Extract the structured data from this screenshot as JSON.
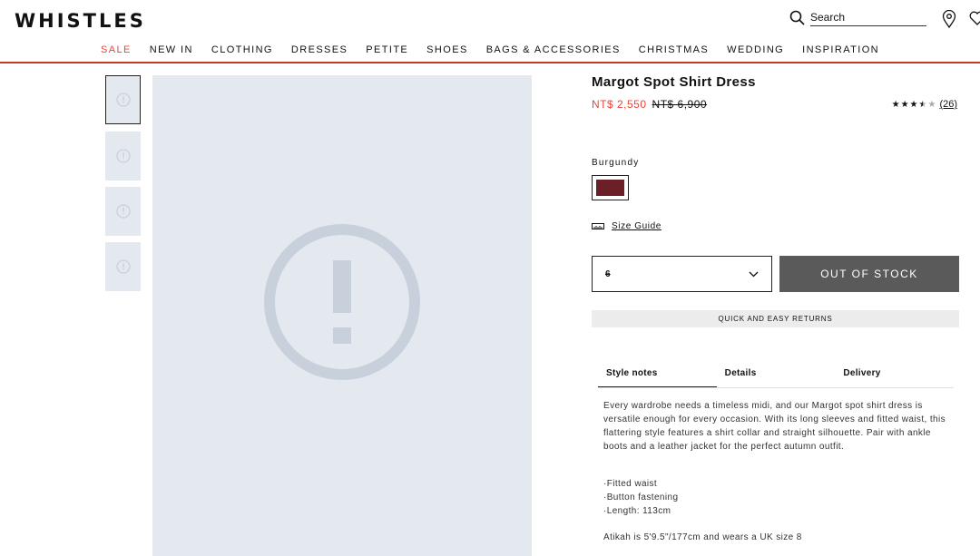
{
  "header": {
    "logo": "WHISTLES",
    "search_placeholder": "Search"
  },
  "nav": [
    "SALE",
    "NEW IN",
    "CLOTHING",
    "DRESSES",
    "PETITE",
    "SHOES",
    "BAGS & ACCESSORIES",
    "CHRISTMAS",
    "WEDDING",
    "INSPIRATION"
  ],
  "colors": {
    "sale": "#e8463a",
    "accent_line": "#c0392b",
    "swatch": "#6b1f26",
    "out_of_stock_bg": "#5a5a5a",
    "image_placeholder": "#e4e9f0"
  },
  "product": {
    "title": "Margot Spot Shirt Dress",
    "sale_price": "NT$ 2,550",
    "original_price": "NT$ 6,900",
    "rating": 3.5,
    "rating_max": 5,
    "review_count": "(26)",
    "color_name": "Burgundy",
    "size_guide": "Size Guide",
    "selected_size": "6",
    "out_of_stock": "OUT OF STOCK",
    "returns": "QUICK AND EASY RETURNS",
    "tabs": [
      "Style notes",
      "Details",
      "Delivery"
    ],
    "description": "Every wardrobe needs a timeless midi, and our Margot spot shirt dress is versatile enough for every occasion. With its long sleeves and fitted waist, this flattering style features a shirt collar and straight silhouette. Pair with ankle boots and a leather jacket for the perfect autumn outfit.",
    "bullets": [
      "·Fitted waist",
      "·Button fastening",
      "·Length: 113cm"
    ],
    "model_info": "Atikah is 5'9.5\"/177cm and wears a UK size 8"
  }
}
